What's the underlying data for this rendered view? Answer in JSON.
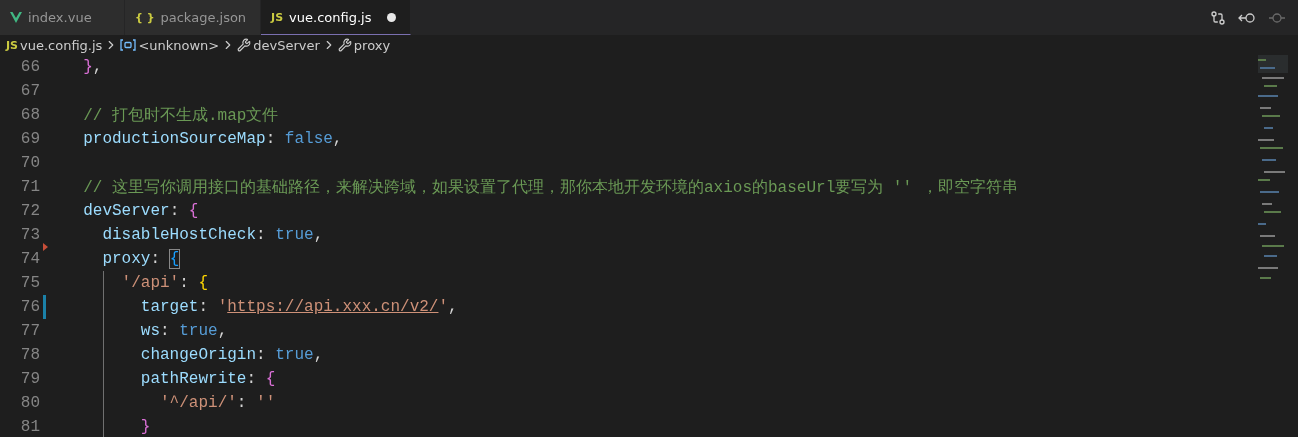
{
  "tabs": [
    {
      "label": "index.vue",
      "kind": "vue",
      "selected": false,
      "dirty": false
    },
    {
      "label": "package.json",
      "kind": "json",
      "icon_text": "{ }",
      "selected": false,
      "dirty": false
    },
    {
      "label": "vue.config.js",
      "kind": "js",
      "icon_text": "JS",
      "selected": true,
      "dirty": true
    }
  ],
  "breadcrumbs": [
    {
      "kind": "file",
      "icon_text": "JS",
      "label": "vue.config.js"
    },
    {
      "kind": "symbol",
      "label": "<unknown>"
    },
    {
      "kind": "property",
      "label": "devServer"
    },
    {
      "kind": "property",
      "label": "proxy"
    }
  ],
  "lines": [
    {
      "number": "66",
      "tokens": [
        {
          "t": "  }",
          "kind": "orchid"
        },
        {
          "t": ",",
          "kind": "punct"
        }
      ]
    },
    {
      "number": "67"
    },
    {
      "number": "68",
      "tokens": [
        {
          "t": "  // 打包时不生成.map文件",
          "kind": "comment"
        }
      ]
    },
    {
      "number": "69",
      "tokens": [
        {
          "t": "  productionSourceMap",
          "kind": "key"
        },
        {
          "t": ": ",
          "kind": "punct"
        },
        {
          "t": "false",
          "kind": "bool"
        },
        {
          "t": ",",
          "kind": "punct"
        }
      ]
    },
    {
      "number": "70"
    },
    {
      "number": "71",
      "tokens": [
        {
          "t": "  // 这里写你调用接口的基础路径，来解决跨域，如果设置了代理，那你本地开发环境的axios的baseUrl要写为 '' ，即空字符串",
          "kind": "comment"
        }
      ]
    },
    {
      "number": "72",
      "tokens": [
        {
          "t": "  devServer",
          "kind": "key"
        },
        {
          "t": ": ",
          "kind": "punct"
        },
        {
          "t": "{",
          "kind": "orchid"
        }
      ]
    },
    {
      "number": "73",
      "tokens": [
        {
          "t": "    disableHostCheck",
          "kind": "key"
        },
        {
          "t": ": ",
          "kind": "punct"
        },
        {
          "t": "true",
          "kind": "bool"
        },
        {
          "t": ",",
          "kind": "punct"
        }
      ]
    },
    {
      "number": "74",
      "deleted_above": true,
      "tokens": [
        {
          "t": "    proxy",
          "kind": "key"
        },
        {
          "t": ": ",
          "kind": "punct"
        },
        {
          "t": "{",
          "kind": "blue",
          "matched": true
        }
      ]
    },
    {
      "number": "75",
      "guide": true,
      "tokens": [
        {
          "t": "      '/api'",
          "kind": "string"
        },
        {
          "t": ": ",
          "kind": "punct"
        },
        {
          "t": "{",
          "kind": "gold"
        }
      ]
    },
    {
      "number": "76",
      "guide": true,
      "modified": true,
      "tokens": [
        {
          "t": "        target",
          "kind": "key"
        },
        {
          "t": ": ",
          "kind": "punct"
        },
        {
          "t": "'",
          "kind": "string"
        },
        {
          "t": "https://api.xxx.cn/v2/",
          "kind": "url"
        },
        {
          "t": "'",
          "kind": "string"
        },
        {
          "t": ",",
          "kind": "punct"
        }
      ]
    },
    {
      "number": "77",
      "guide": true,
      "tokens": [
        {
          "t": "        ws",
          "kind": "key"
        },
        {
          "t": ": ",
          "kind": "punct"
        },
        {
          "t": "true",
          "kind": "bool"
        },
        {
          "t": ",",
          "kind": "punct"
        }
      ]
    },
    {
      "number": "78",
      "guide": true,
      "tokens": [
        {
          "t": "        changeOrigin",
          "kind": "key"
        },
        {
          "t": ": ",
          "kind": "punct"
        },
        {
          "t": "true",
          "kind": "bool"
        },
        {
          "t": ",",
          "kind": "punct"
        }
      ]
    },
    {
      "number": "79",
      "guide": true,
      "tokens": [
        {
          "t": "        pathRewrite",
          "kind": "key"
        },
        {
          "t": ": ",
          "kind": "punct"
        },
        {
          "t": "{",
          "kind": "orchid"
        }
      ]
    },
    {
      "number": "80",
      "guide": true,
      "tokens": [
        {
          "t": "          '^/api/'",
          "kind": "string"
        },
        {
          "t": ": ",
          "kind": "punct"
        },
        {
          "t": "''",
          "kind": "string"
        }
      ]
    },
    {
      "number": "81",
      "guide": true,
      "tokens": [
        {
          "t": "        }",
          "kind": "orchid"
        }
      ]
    }
  ]
}
